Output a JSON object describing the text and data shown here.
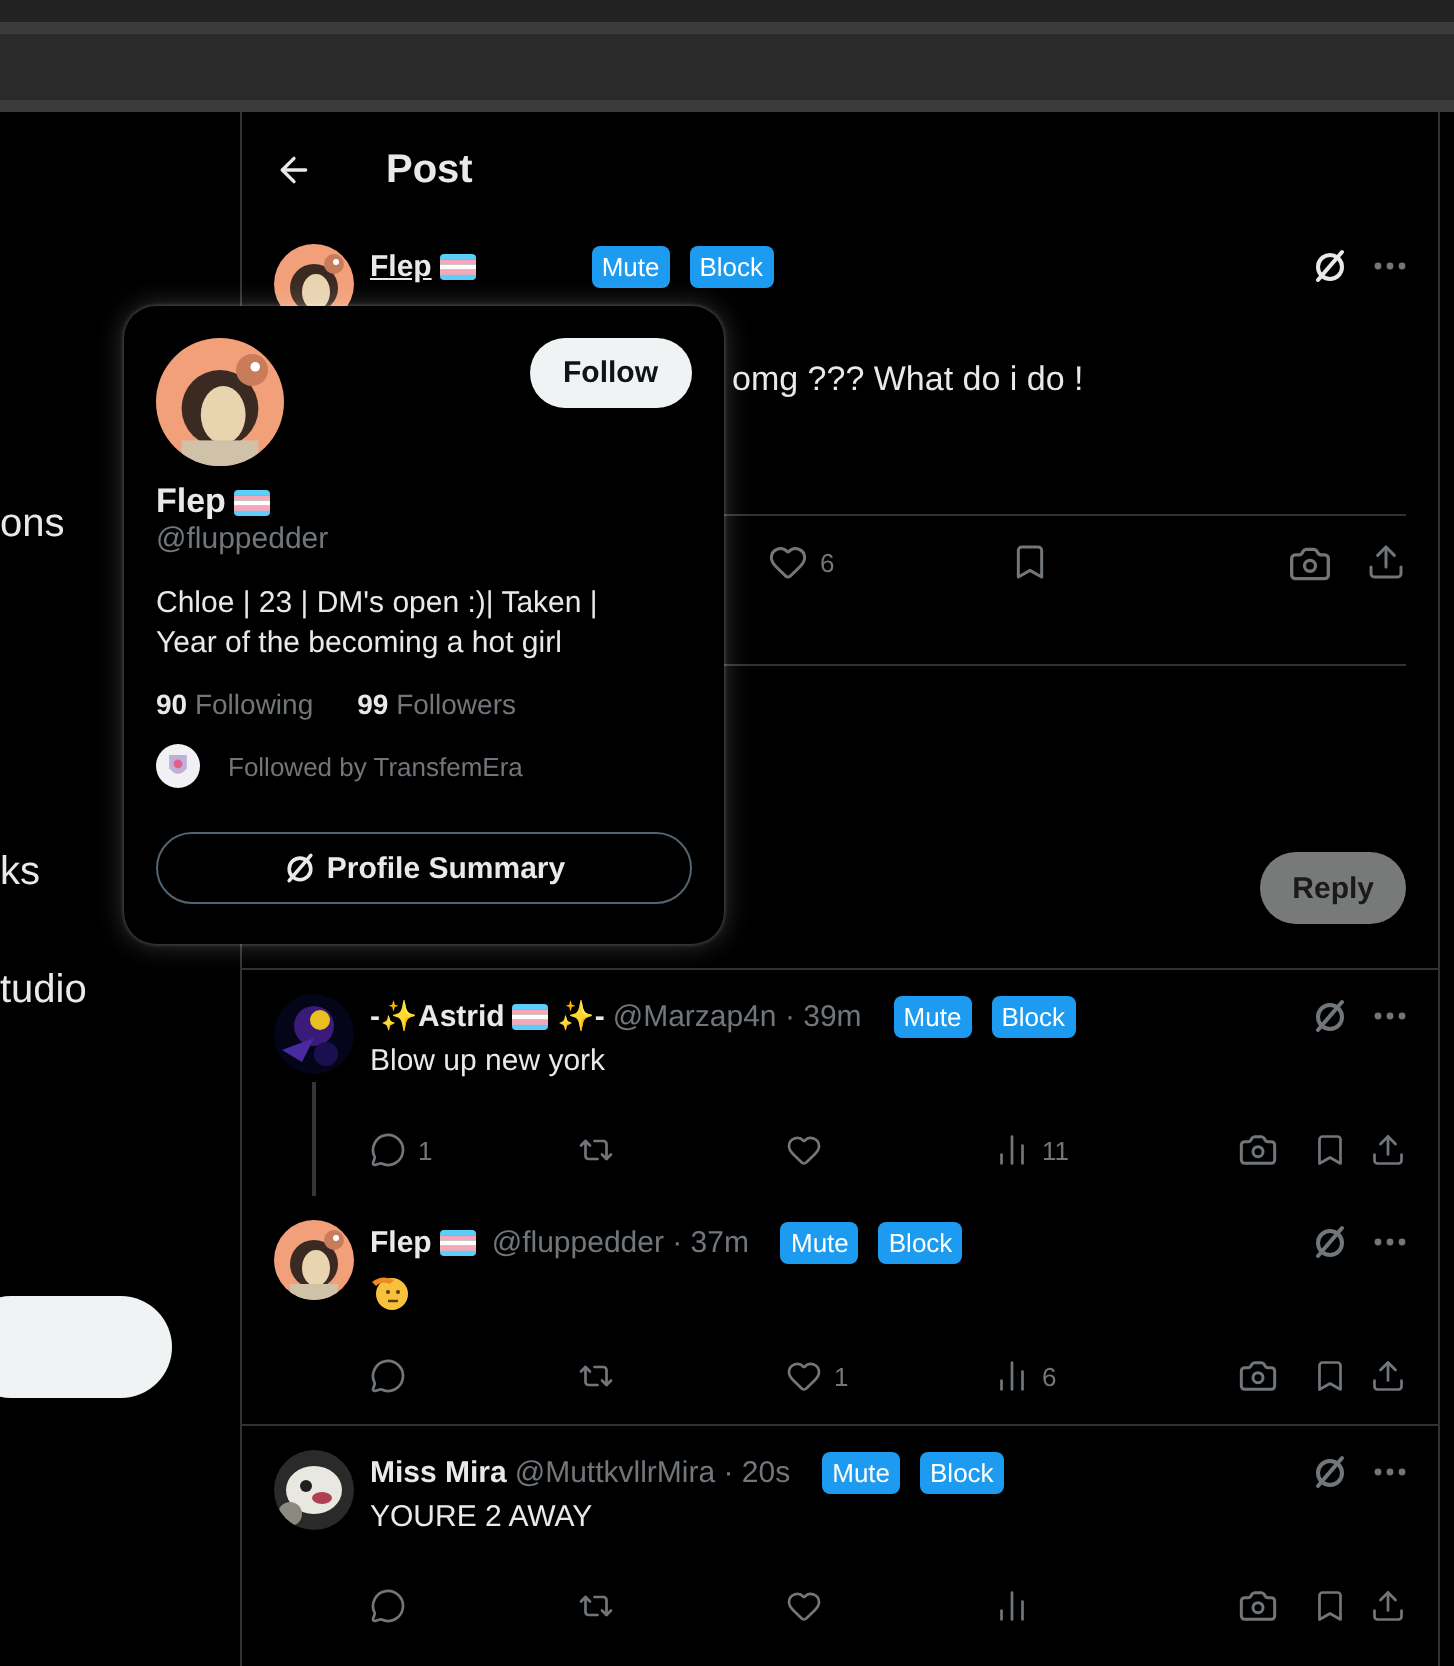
{
  "sidebar": {
    "items": [
      "ons",
      "ks",
      "tudio"
    ]
  },
  "header": {
    "title": "Post"
  },
  "main_post": {
    "name": "Flep",
    "flag": true,
    "text": "omg ??? What do i do !",
    "buttons": [
      "Mute",
      "Block"
    ],
    "actions": [
      {
        "kind": "like",
        "count": "6"
      },
      {
        "kind": "bookmark"
      },
      {
        "kind": "camera"
      },
      {
        "kind": "share"
      }
    ]
  },
  "composer": {
    "button": "Reply",
    "disabled": true
  },
  "replies": [
    {
      "name": "-✨Astrid",
      "flag": true,
      "name_suffix": "✨-",
      "meta": "@Marzap4n · 39m",
      "buttons": [
        "Mute",
        "Block"
      ],
      "threaded": true,
      "body": {
        "kind": "text",
        "text": "Blow up new york"
      },
      "actions": [
        {
          "kind": "reply",
          "count": "1"
        },
        {
          "kind": "repost"
        },
        {
          "kind": "like"
        },
        {
          "kind": "views",
          "count": "11"
        }
      ]
    },
    {
      "name": "Flep",
      "flag": true,
      "meta": "@fluppedder · 37m",
      "buttons": [
        "Mute",
        "Block"
      ],
      "threaded": false,
      "body": {
        "kind": "emoji"
      },
      "actions": [
        {
          "kind": "reply"
        },
        {
          "kind": "repost"
        },
        {
          "kind": "like",
          "count": "1"
        },
        {
          "kind": "views",
          "count": "6"
        }
      ]
    },
    {
      "name": "Miss Mira",
      "flag": false,
      "meta": "@MuttkvllrMira · 20s",
      "buttons": [
        "Mute",
        "Block"
      ],
      "threaded": false,
      "body": {
        "kind": "text",
        "text": "YOURE 2 AWAY"
      },
      "actions": [
        {
          "kind": "reply"
        },
        {
          "kind": "repost"
        },
        {
          "kind": "like"
        },
        {
          "kind": "views"
        }
      ]
    }
  ],
  "profile_card": {
    "follow_button": "Follow",
    "name": "Flep",
    "flag": true,
    "handle": "@fluppedder",
    "bio": "Chloe | 23 | DM's open :)| Taken | Year of the becoming a hot girl",
    "stats": [
      "**90** Following",
      "**99** Followers"
    ],
    "followed_by": "Followed by TransfemEra",
    "summary_button": "Profile Summary"
  }
}
